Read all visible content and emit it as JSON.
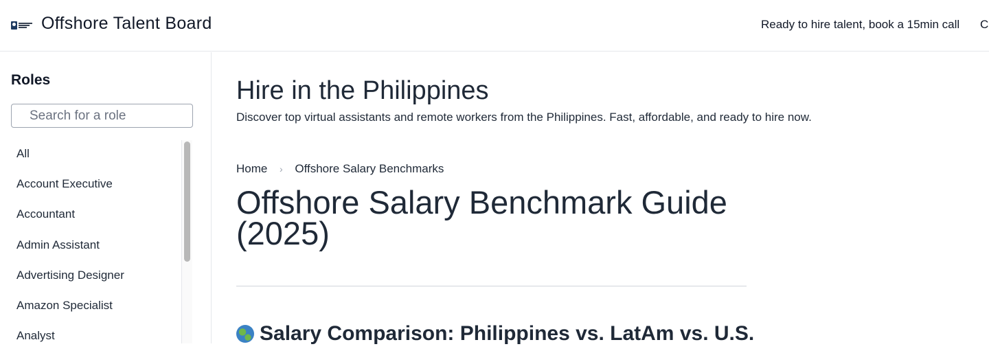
{
  "header": {
    "brand": "Offshore Talent Board",
    "cta_link": "Ready to hire talent, book a 15min call",
    "extra_link": "Ca"
  },
  "sidebar": {
    "title": "Roles",
    "search_placeholder": "Search for a role",
    "roles": [
      "All",
      "Account Executive",
      "Accountant",
      "Admin Assistant",
      "Advertising Designer",
      "Amazon Specialist",
      "Analyst"
    ]
  },
  "main": {
    "hero_title": "Hire in the Philippines",
    "hero_subtitle": "Discover top virtual assistants and remote workers from the Philippines. Fast, affordable, and ready to hire now.",
    "breadcrumb": {
      "home": "Home",
      "separator": "›",
      "current": "Offshore Salary Benchmarks"
    },
    "article_title": "Offshore Salary Benchmark Guide (2025)",
    "section_title": "Salary Comparison: Philippines vs. LatAm vs. U.S."
  },
  "icons": {
    "logo": "offshore-talent-board-logo",
    "section": "globe-icon"
  },
  "colors": {
    "text": "#1f2937",
    "border": "#e5e7eb",
    "scrollbar": "#b8b8b8"
  }
}
